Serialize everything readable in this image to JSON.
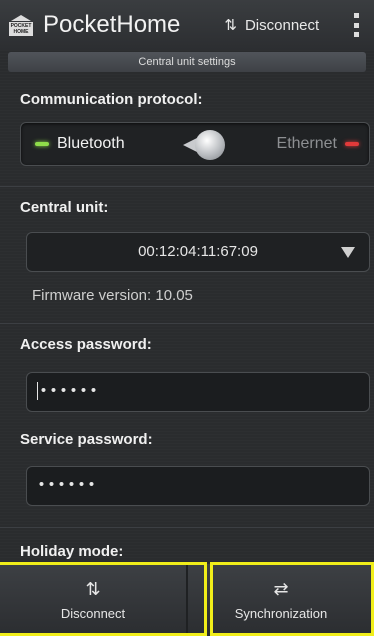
{
  "actionbar": {
    "logo_top": "POCKET",
    "logo_bottom": "HOME",
    "title": "PocketHome",
    "disconnect_label": "Disconnect",
    "disconnect_icon": "connect-arrows-icon",
    "overflow_icon": "overflow-menu-icon"
  },
  "subheader": {
    "title": "Central unit settings"
  },
  "protocol": {
    "label": "Communication protocol:",
    "left_option": "Bluetooth",
    "right_option": "Ethernet",
    "selected": "Bluetooth",
    "left_led_color": "#8fdc4a",
    "right_led_color": "#e23a3a"
  },
  "central_unit": {
    "label": "Central unit:",
    "selected_value": "00:12:04:11:67:09",
    "firmware": "Firmware version: 10.05"
  },
  "access_password": {
    "label": "Access password:",
    "value": "••••••"
  },
  "service_password": {
    "label": "Service password:",
    "value": "••••••"
  },
  "holiday": {
    "label": "Holiday mode:"
  },
  "bottom": {
    "disconnect_label": "Disconnect",
    "disconnect_icon": "connect-arrows-icon",
    "sync_label": "Synchronization",
    "sync_icon": "sync-arrows-icon"
  },
  "highlight_color": "#f1ee1a"
}
